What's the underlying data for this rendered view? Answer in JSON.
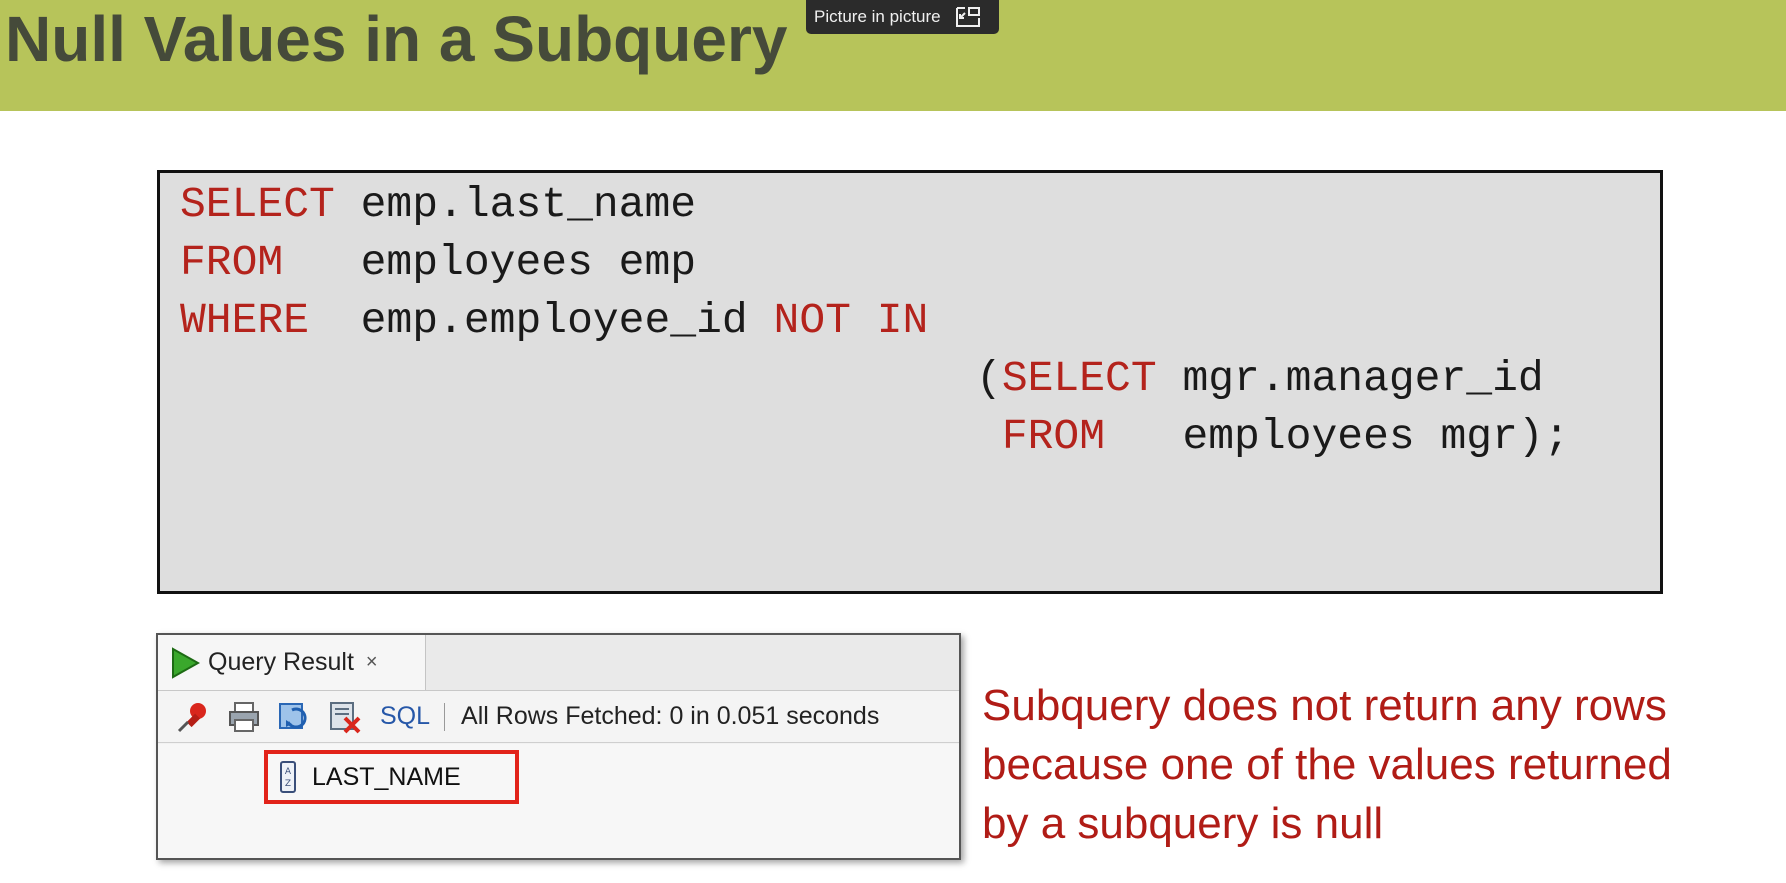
{
  "slide": {
    "title": "Null Values in a Subquery",
    "accent_color": "#b7c45a"
  },
  "overlay": {
    "pip_label": "Picture in picture",
    "pip_icon": "picture-in-picture-icon"
  },
  "code": {
    "lines": [
      {
        "keyword": "SELECT",
        "rest": " emp.last_name"
      },
      {
        "keyword": "FROM",
        "rest": "   employees emp"
      },
      {
        "keyword": "WHERE",
        "rest": "  emp.employee_id ",
        "keyword2": "NOT IN"
      },
      {
        "prefix": "(",
        "keyword": "SELECT",
        "rest": " mgr.manager_id"
      },
      {
        "prefix": " ",
        "keyword": "FROM",
        "rest": "   employees mgr);"
      }
    ],
    "keyword_color": "#b4231c"
  },
  "result_panel": {
    "tab_label": "Query Result",
    "tab_close": "×",
    "toolbar": {
      "icons": [
        "pin-icon",
        "print-icon",
        "refresh-icon",
        "clear-icon"
      ],
      "sql_label": "SQL",
      "status": "All Rows Fetched: 0 in 0.051 seconds"
    },
    "column_header": "LAST_NAME",
    "highlight_color": "#e2231a"
  },
  "note": {
    "lines": [
      "Subquery does not return any rows",
      "because  one of the values returned",
      "by a subquery is null"
    ],
    "color": "#b01c16"
  }
}
